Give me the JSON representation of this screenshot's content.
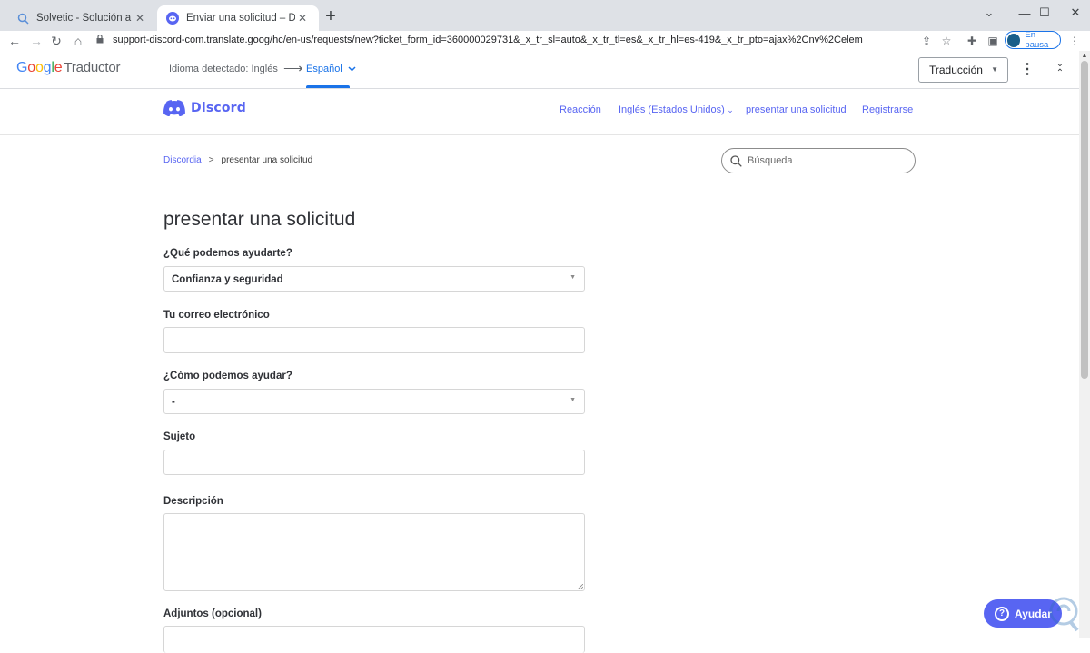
{
  "browser": {
    "tabs": [
      {
        "title": "Solvetic - Solución a los problem",
        "favicon": "search-icon"
      },
      {
        "title": "Enviar una solicitud – Discordia",
        "favicon": "discord-icon"
      }
    ],
    "url": "support-discord-com.translate.goog/hc/en-us/requests/new?ticket_form_id=360000029731&_x_tr_sl=auto&_x_tr_tl=es&_x_tr_hl=es-419&_x_tr_pto=ajax%2Cnv%2Celem",
    "profile_label": "En pausa"
  },
  "translate_bar": {
    "logo_google": "Google",
    "logo_product": "Traductor",
    "detected": "Idioma detectado: Inglés",
    "target": "Español",
    "mode": "Traducción"
  },
  "discord_header": {
    "brand": "Discord",
    "nav": [
      "Reacción",
      "Inglés (Estados Unidos)",
      "presentar una solicitud",
      "Registrarse"
    ]
  },
  "breadcrumb": {
    "root": "Discordia",
    "separator": ">",
    "current": "presentar una solicitud"
  },
  "search": {
    "placeholder": "Búsqueda"
  },
  "form": {
    "title": "presentar una solicitud",
    "help_label": "¿Qué podemos ayudarte?",
    "help_value": "Confianza y seguridad",
    "email_label": "Tu correo electrónico",
    "email_value": "",
    "how_label": "¿Cómo podemos ayudar?",
    "how_value": "-",
    "subject_label": "Sujeto",
    "subject_value": "",
    "description_label": "Descripción",
    "description_value": "",
    "attachments_label": "Adjuntos  (opcional)"
  },
  "help_widget": {
    "label": "Ayudar"
  },
  "colors": {
    "discord_blurple": "#5865f2",
    "google_blue": "#1a73e8"
  }
}
